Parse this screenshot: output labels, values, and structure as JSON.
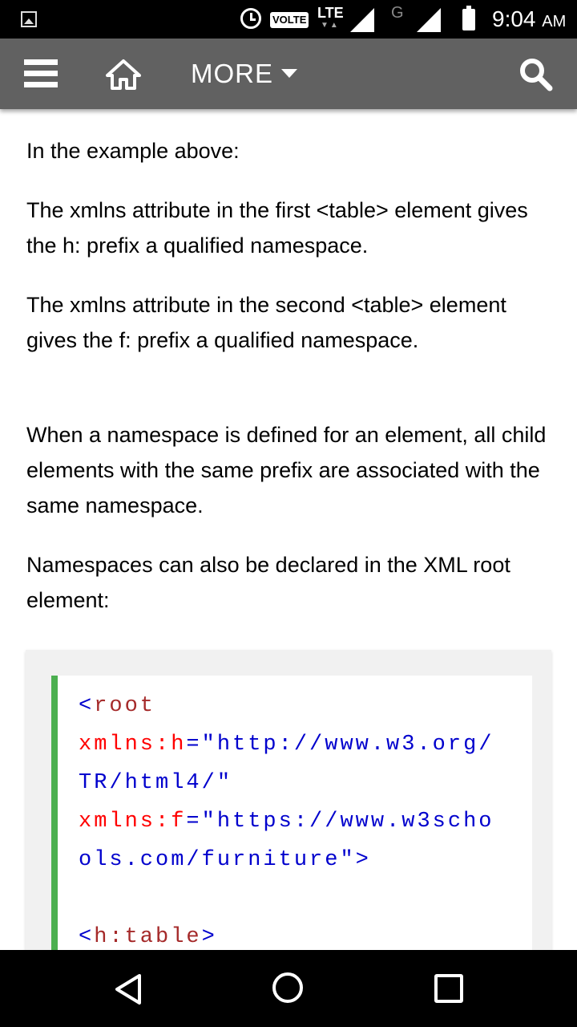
{
  "status_bar": {
    "volte": "VOLTE",
    "network": "LTE",
    "second_network": "G",
    "time": "9:04",
    "ampm": "AM"
  },
  "top_bar": {
    "more_label": "MORE",
    "icons": [
      "menu-icon",
      "home-icon",
      "search-icon"
    ]
  },
  "content": {
    "paragraphs": [
      "In the example above:",
      "The xmlns attribute in the first <table> element gives the h: prefix a qualified namespace.",
      "The xmlns attribute in the second <table> element gives the f: prefix a qualified namespace.",
      "When a namespace is defined for an element, all child elements with the same prefix are associated with the same namespace.",
      "Namespaces can also be declared in the XML root element:"
    ],
    "code": {
      "line1_bracket": "<",
      "line1_tag": "root",
      "line2_attr": "xmlns:h",
      "line2_eq": "=",
      "line2_val": "\"http://www.w3.org/",
      "line3_val": "TR/html4/\"",
      "line4_attr": "xmlns:f",
      "line4_eq": "=",
      "line4_val": "\"https://www.w3scho",
      "line5_val": "ols.com/furniture\"",
      "line5_close": ">",
      "line7_bracket_open": "<",
      "line7_tag": "h:table",
      "line7_bracket_close": ">"
    }
  },
  "nav_bar": {
    "icons": [
      "back-icon",
      "home-circle-icon",
      "recent-apps-icon"
    ]
  },
  "colors": {
    "top_bar": "#616161",
    "code_accent": "#4caf50",
    "code_tag": "#a52a2a",
    "code_attr": "#ff0000",
    "code_value": "#0000cd"
  }
}
